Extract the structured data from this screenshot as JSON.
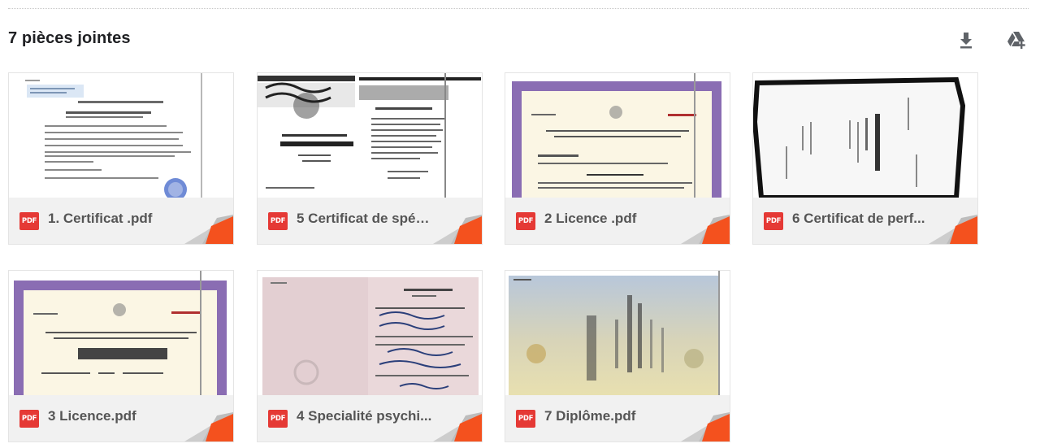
{
  "attachments_title": "7 pièces jointes",
  "actions": {
    "download_icon": "download-icon",
    "drive_icon": "add-to-drive-icon"
  },
  "colors": {
    "pdf_badge": "#e53935",
    "corner_accent": "#f4511e",
    "footer_bg": "#f1f1f1",
    "filename_text": "#555555"
  },
  "attachments": [
    {
      "name": "1. Certificat .pdf",
      "type": "pdf",
      "badge": "PDF",
      "thumb": "text-document"
    },
    {
      "name": "5 Certificat de spéc...",
      "type": "pdf",
      "badge": "PDF",
      "thumb": "ornate-certificate"
    },
    {
      "name": "2 Licence .pdf",
      "type": "pdf",
      "badge": "PDF",
      "thumb": "purple-border-license"
    },
    {
      "name": "6 Certificat de perf...",
      "type": "pdf",
      "badge": "PDF",
      "thumb": "rotated-scan"
    },
    {
      "name": "3 Licence.pdf",
      "type": "pdf",
      "badge": "PDF",
      "thumb": "purple-border-license"
    },
    {
      "name": "4 Specialité psychi...",
      "type": "pdf",
      "badge": "PDF",
      "thumb": "pink-certificate"
    },
    {
      "name": "7 Diplôme.pdf",
      "type": "pdf",
      "badge": "PDF",
      "thumb": "diploma"
    }
  ]
}
